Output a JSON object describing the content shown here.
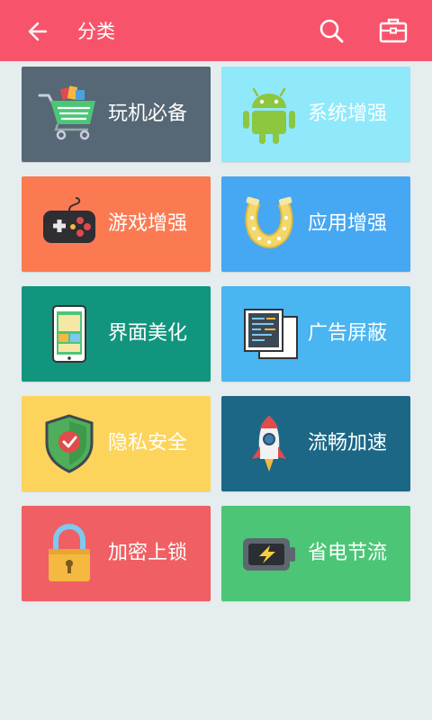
{
  "header": {
    "title": "分类",
    "back_icon": "back-arrow-icon",
    "search_icon": "search-icon",
    "toolbox_icon": "toolbox-icon"
  },
  "categories": [
    {
      "label": "玩机必备",
      "color": "#566775",
      "icon": "shopping-cart-icon"
    },
    {
      "label": "系统增强",
      "color": "#8FE9FB",
      "icon": "android-robot-icon"
    },
    {
      "label": "游戏增强",
      "color": "#FB7A52",
      "icon": "gamepad-icon"
    },
    {
      "label": "应用增强",
      "color": "#46A7F3",
      "icon": "horseshoe-icon"
    },
    {
      "label": "界面美化",
      "color": "#12957E",
      "icon": "phone-theme-icon"
    },
    {
      "label": "广告屏蔽",
      "color": "#49B5F1",
      "icon": "window-block-icon"
    },
    {
      "label": "隐私安全",
      "color": "#FDD45B",
      "icon": "shield-check-icon"
    },
    {
      "label": "流畅加速",
      "color": "#1C6786",
      "icon": "rocket-icon"
    },
    {
      "label": "加密上锁",
      "color": "#EF5F63",
      "icon": "padlock-icon"
    },
    {
      "label": "省电节流",
      "color": "#4CC676",
      "icon": "battery-bolt-icon"
    }
  ]
}
